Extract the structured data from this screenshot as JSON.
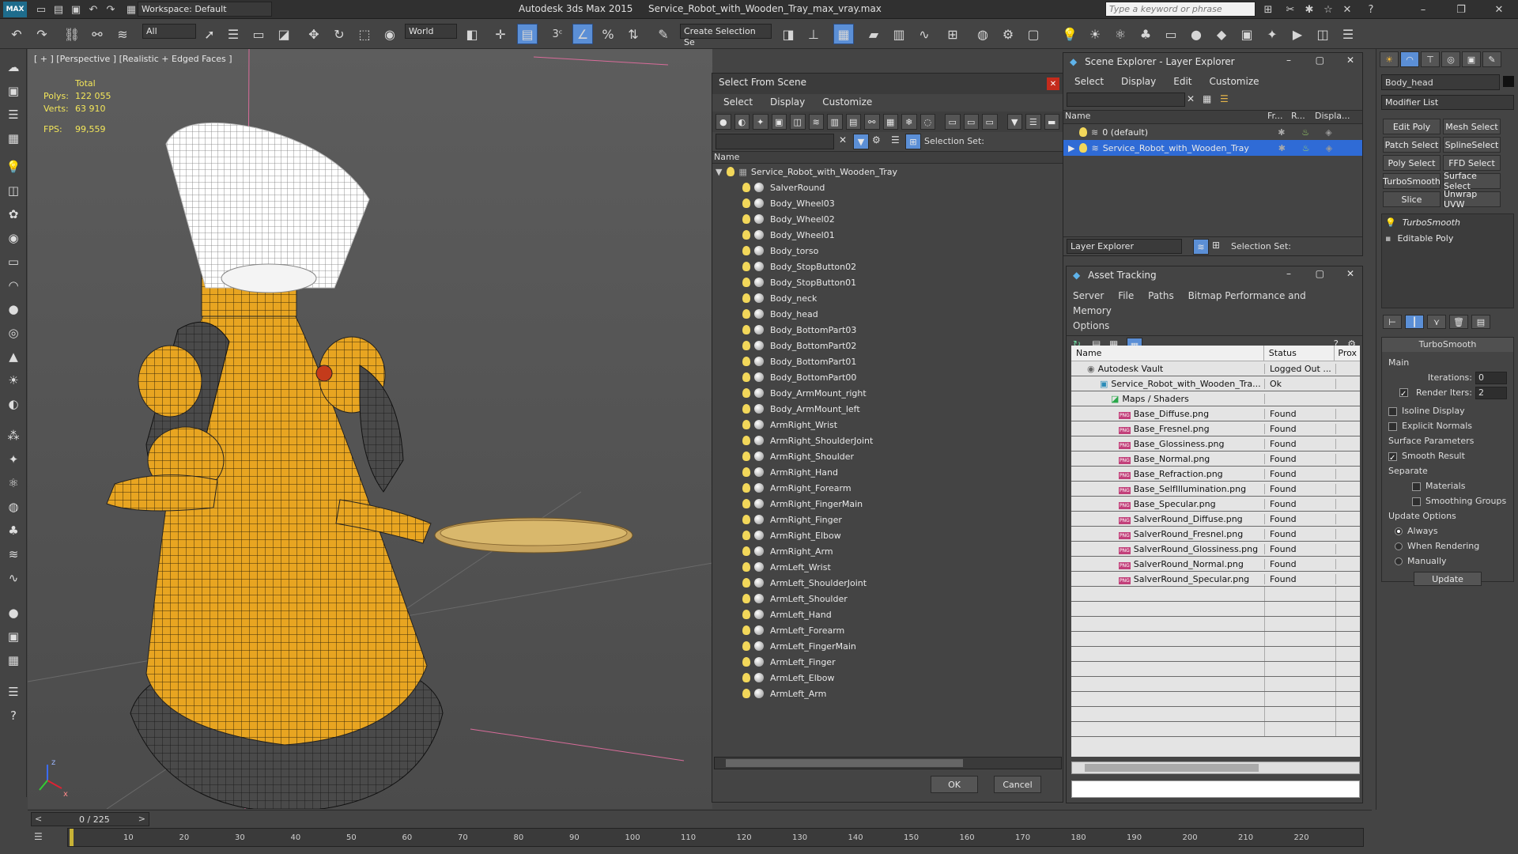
{
  "titlebar": {
    "app_logo": "MAX",
    "workspace": "Workspace: Default",
    "app_name": "Autodesk 3ds Max  2015",
    "file_name": "Service_Robot_with_Wooden_Tray_max_vray.max",
    "search_placeholder": "Type a keyword or phrase"
  },
  "toolbar": {
    "filter": "All",
    "coord_system": "World",
    "snap_angle": "3",
    "selection_set": "Create Selection Se"
  },
  "viewport": {
    "label": "[ + ] [Perspective ] [Realistic + Edged Faces ]",
    "stats_total_label": "Total",
    "polys_label": "Polys:",
    "polys_value": "122 055",
    "verts_label": "Verts:",
    "verts_value": "63 910",
    "fps_label": "FPS:",
    "fps_value": "99,559",
    "axis_z": "z",
    "axis_x": "x"
  },
  "select_from_scene": {
    "title": "Select From Scene",
    "menu": [
      "Select",
      "Display",
      "Customize"
    ],
    "selection_set_label": "Selection Set:",
    "column_name": "Name",
    "root": "Service_Robot_with_Wooden_Tray",
    "items": [
      "SalverRound",
      "Body_Wheel03",
      "Body_Wheel02",
      "Body_Wheel01",
      "Body_torso",
      "Body_StopButton02",
      "Body_StopButton01",
      "Body_neck",
      "Body_head",
      "Body_BottomPart03",
      "Body_BottomPart02",
      "Body_BottomPart01",
      "Body_BottomPart00",
      "Body_ArmMount_right",
      "Body_ArmMount_left",
      "ArmRight_Wrist",
      "ArmRight_ShoulderJoint",
      "ArmRight_Shoulder",
      "ArmRight_Hand",
      "ArmRight_Forearm",
      "ArmRight_FingerMain",
      "ArmRight_Finger",
      "ArmRight_Elbow",
      "ArmRight_Arm",
      "ArmLeft_Wrist",
      "ArmLeft_ShoulderJoint",
      "ArmLeft_Shoulder",
      "ArmLeft_Hand",
      "ArmLeft_Forearm",
      "ArmLeft_FingerMain",
      "ArmLeft_Finger",
      "ArmLeft_Elbow",
      "ArmLeft_Arm"
    ],
    "ok": "OK",
    "cancel": "Cancel"
  },
  "scene_explorer": {
    "title": "Scene Explorer - Layer Explorer",
    "menu": [
      "Select",
      "Display",
      "Edit",
      "Customize"
    ],
    "col_name": "Name",
    "col_fr": "Fr...",
    "col_r": "R...",
    "col_disp": "Displa...",
    "layers": [
      "0 (default)",
      "Service_Robot_with_Wooden_Tray"
    ],
    "footer_dropdown": "Layer Explorer",
    "selection_set_label": "Selection Set:"
  },
  "asset_tracking": {
    "title": "Asset Tracking",
    "menu": [
      "Server",
      "File",
      "Paths",
      "Bitmap Performance and Memory",
      "Options"
    ],
    "col_name": "Name",
    "col_status": "Status",
    "col_prox": "Prox",
    "rows": [
      {
        "name": "Autodesk Vault",
        "status": "Logged Out ..."
      },
      {
        "name": "Service_Robot_with_Wooden_Tra...",
        "status": "Ok"
      },
      {
        "name": "Maps / Shaders",
        "status": ""
      },
      {
        "name": "Base_Diffuse.png",
        "status": "Found"
      },
      {
        "name": "Base_Fresnel.png",
        "status": "Found"
      },
      {
        "name": "Base_Glossiness.png",
        "status": "Found"
      },
      {
        "name": "Base_Normal.png",
        "status": "Found"
      },
      {
        "name": "Base_Refraction.png",
        "status": "Found"
      },
      {
        "name": "Base_SelfIllumination.png",
        "status": "Found"
      },
      {
        "name": "Base_Specular.png",
        "status": "Found"
      },
      {
        "name": "SalverRound_Diffuse.png",
        "status": "Found"
      },
      {
        "name": "SalverRound_Fresnel.png",
        "status": "Found"
      },
      {
        "name": "SalverRound_Glossiness.png",
        "status": "Found"
      },
      {
        "name": "SalverRound_Normal.png",
        "status": "Found"
      },
      {
        "name": "SalverRound_Specular.png",
        "status": "Found"
      }
    ],
    "png_tag": "PNG"
  },
  "command_panel": {
    "object_name": "Body_head",
    "modifier_list": "Modifier List",
    "buttons": [
      "Edit Poly",
      "Mesh Select",
      "Patch Select",
      "SplineSelect",
      "Poly Select",
      "FFD Select",
      "TurboSmooth",
      "Surface Select",
      "Slice",
      "Unwrap UVW"
    ],
    "stack": [
      "TurboSmooth",
      "Editable Poly"
    ],
    "rollout_title": "TurboSmooth",
    "main_label": "Main",
    "iterations_label": "Iterations:",
    "iterations_value": "0",
    "render_iters_label": "Render Iters:",
    "render_iters_value": "2",
    "isoline": "Isoline Display",
    "explicit_normals": "Explicit Normals",
    "surface_params": "Surface Parameters",
    "smooth_result": "Smooth Result",
    "separate": "Separate",
    "materials": "Materials",
    "smoothing_groups": "Smoothing Groups",
    "update_options": "Update Options",
    "always": "Always",
    "when_rendering": "When Rendering",
    "manually": "Manually",
    "update": "Update"
  },
  "timeline": {
    "frame": "0 / 225",
    "ticks": [
      "10",
      "20",
      "30",
      "40",
      "50",
      "60",
      "70",
      "80",
      "90",
      "100",
      "110",
      "120",
      "130",
      "140",
      "150",
      "160",
      "170",
      "180",
      "190",
      "200",
      "210",
      "220"
    ]
  },
  "colors": {
    "robot_yellow": "#e8a521",
    "selection_blue": "#2f6bd6",
    "stats_yellow": "#f3e65a"
  }
}
